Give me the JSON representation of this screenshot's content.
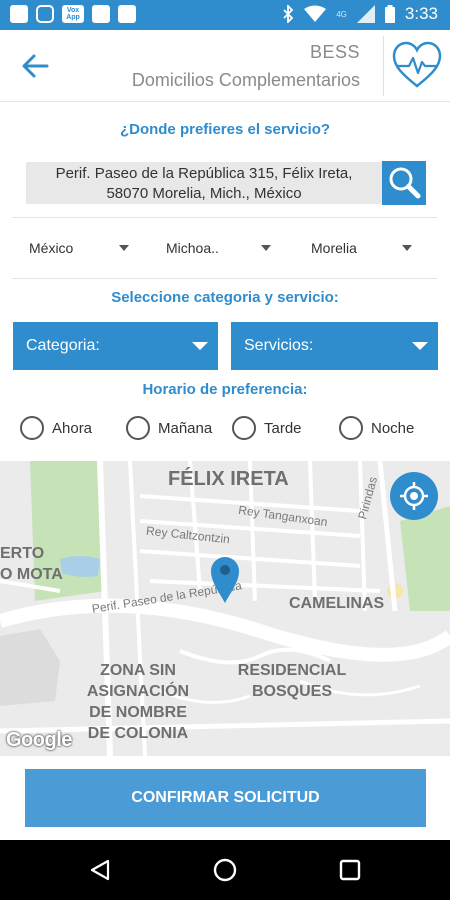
{
  "status_bar": {
    "time": "3:33",
    "network": "4G",
    "left_icons": [
      "notification-icon",
      "instagram-icon",
      "voxapp-icon",
      "image-icon",
      "translate-icon"
    ],
    "voxapp_label": "Vox App",
    "right_icons": [
      "bluetooth-icon",
      "wifi-icon",
      "signal-icon",
      "battery-icon"
    ]
  },
  "header": {
    "title": "BESS",
    "subtitle": "Domicilios Complementarios",
    "back_icon": "arrow-left-icon",
    "logo_icon": "heart-pulse-icon"
  },
  "location": {
    "question": "¿Donde prefieres el servicio?",
    "address_line1": "Perif. Paseo de la República 315, Félix Ireta,",
    "address_line2": "58070 Morelia, Mich., México",
    "search_icon": "search-icon"
  },
  "dropdowns": {
    "country": "México",
    "state": "Michoa..",
    "city": "Morelia"
  },
  "category_section": {
    "question": "Seleccione categoria y servicio:",
    "category_label": "Categoria:",
    "services_label": "Servicios:"
  },
  "schedule": {
    "question": "Horario de preferencia:",
    "options": [
      "Ahora",
      "Mañana",
      "Tarde",
      "Noche"
    ]
  },
  "map": {
    "labels": {
      "felix_ireta": "FÉLIX IRETA",
      "camelinas": "CAMELINAS",
      "zona": "ZONA SIN ASIGNACIÓN DE NOMBRE DE COLONIA",
      "residencial": "RESIDENCIAL BOSQUES",
      "erto": "ERTO",
      "o_mota": "O MOTA"
    },
    "streets": {
      "rey_tangan": "Rey Tanganxoan",
      "rey_calt": "Rey Caltzontzin",
      "perif": "Perif. Paseo de la República",
      "pirindas": "Pirindas"
    },
    "attribution": "Google",
    "locate_icon": "gps-locate-icon",
    "pin_icon": "map-pin-icon"
  },
  "confirm_button": "CONFIRMAR SOLICITUD",
  "nav": {
    "back": "nav-back-icon",
    "home": "nav-home-icon",
    "recents": "nav-recents-icon"
  },
  "colors": {
    "primary": "#2f8ccd",
    "confirm": "#4a9bd6",
    "text_gray": "#8a8a8a"
  }
}
